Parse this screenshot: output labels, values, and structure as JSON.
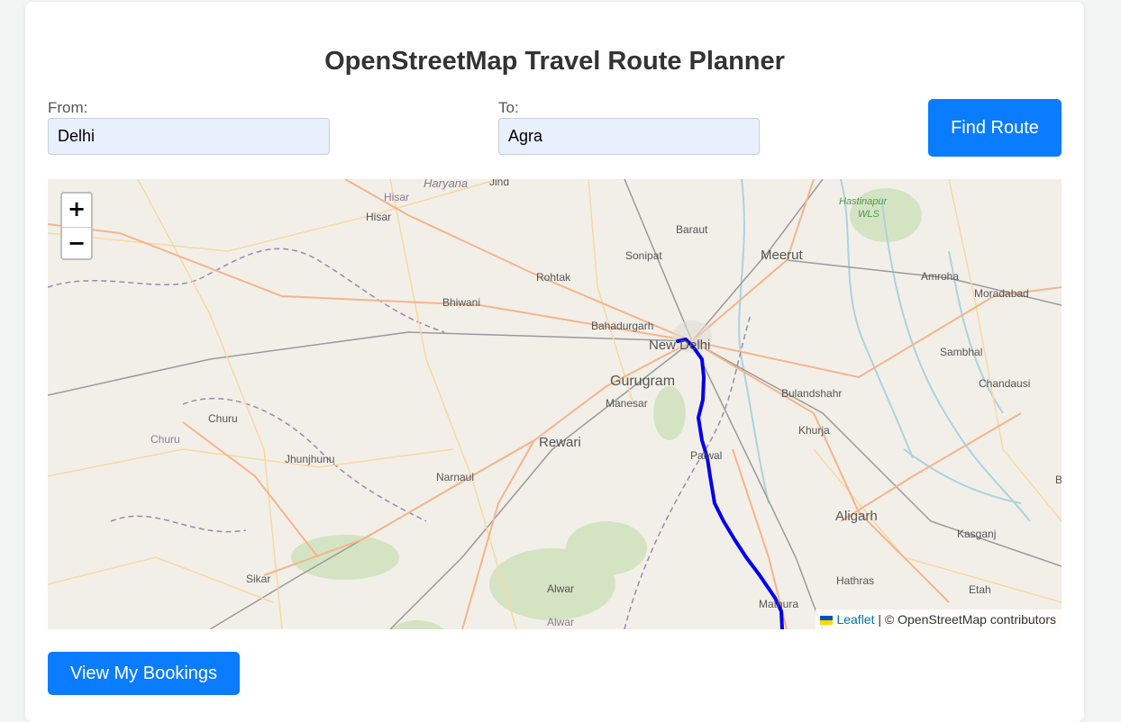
{
  "header": {
    "title": "OpenStreetMap Travel Route Planner"
  },
  "form": {
    "from_label": "From:",
    "from_value": "Delhi",
    "to_label": "To:",
    "to_value": "Agra",
    "find_button": "Find Route"
  },
  "map": {
    "zoom_in": "+",
    "zoom_out": "−",
    "attribution_link": "Leaflet",
    "attribution_sep": " | ",
    "attribution_text": "© OpenStreetMap contributors",
    "places": {
      "haryana": "Haryana",
      "jind": "Jind",
      "hisar1": "Hisar",
      "hisar2": "Hisar",
      "baraut": "Baraut",
      "hastinapur": "Hastinapur",
      "wls": "WLS",
      "sonipat": "Sonipat",
      "meerut": "Meerut",
      "rohtak": "Rohtak",
      "amroha": "Amroha",
      "moradabad": "Moradabad",
      "bhiwani": "Bhiwani",
      "bahadurgarh": "Bahadurgarh",
      "new_delhi": "New Delhi",
      "sambhal": "Sambhal",
      "gurugram": "Gurugram",
      "bulandshahr": "Bulandshahr",
      "chandausi": "Chandausi",
      "manesar": "Manesar",
      "churu": "Churu",
      "churu2": "Churu",
      "khurja": "Khurja",
      "rewari": "Rewari",
      "palwal": "Palwal",
      "jhunjhunu": "Jhunjhunu",
      "narnaul": "Narnaul",
      "aligarh": "Aligarh",
      "b_edge": "B",
      "kasganj": "Kasganj",
      "sikar": "Sikar",
      "hathras": "Hathras",
      "alwar": "Alwar",
      "alwar2": "Alwar",
      "mathura": "Mathura",
      "etah": "Etah"
    },
    "colors": {
      "route": "#0000ee",
      "land": "#f2efe9",
      "primary_road": "#f6b48a",
      "secondary_road": "#f7d9a0",
      "railway": "#9a9a9a",
      "boundary": "#9a8aaa",
      "river": "#aad3df",
      "forest": "#c8dfb2"
    }
  },
  "footer": {
    "bookings_button": "View My Bookings"
  }
}
